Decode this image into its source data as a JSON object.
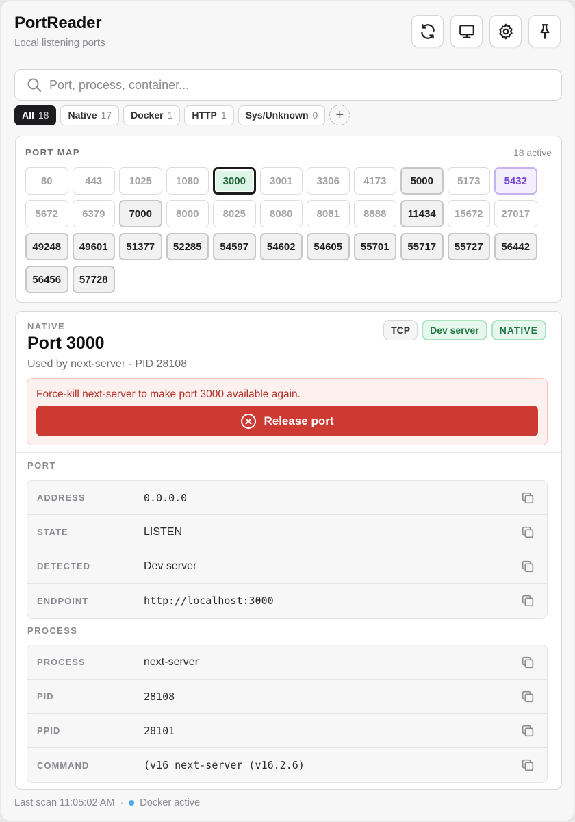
{
  "header": {
    "title": "PortReader",
    "subtitle": "Local listening ports",
    "buttons": [
      "refresh-icon",
      "monitor-icon",
      "gear-icon",
      "pin-icon"
    ]
  },
  "search": {
    "placeholder": "Port, process, container...",
    "value": ""
  },
  "filters": [
    {
      "label": "All",
      "count": "18",
      "active": true
    },
    {
      "label": "Native",
      "count": "17"
    },
    {
      "label": "Docker",
      "count": "1"
    },
    {
      "label": "HTTP",
      "count": "1"
    },
    {
      "label": "Sys/Unknown",
      "count": "0"
    }
  ],
  "port_map": {
    "title": "PORT MAP",
    "active_label": "18 active",
    "ports": [
      {
        "n": "80",
        "s": "off"
      },
      {
        "n": "443",
        "s": "off"
      },
      {
        "n": "1025",
        "s": "off"
      },
      {
        "n": "1080",
        "s": "off"
      },
      {
        "n": "3000",
        "s": "sel"
      },
      {
        "n": "3001",
        "s": "off"
      },
      {
        "n": "3306",
        "s": "off"
      },
      {
        "n": "4173",
        "s": "off"
      },
      {
        "n": "5000",
        "s": "on"
      },
      {
        "n": "5173",
        "s": "off"
      },
      {
        "n": "5432",
        "s": "purple"
      },
      {
        "n": "5672",
        "s": "off"
      },
      {
        "n": "6379",
        "s": "off"
      },
      {
        "n": "7000",
        "s": "on"
      },
      {
        "n": "8000",
        "s": "off"
      },
      {
        "n": "8025",
        "s": "off"
      },
      {
        "n": "8080",
        "s": "off"
      },
      {
        "n": "8081",
        "s": "off"
      },
      {
        "n": "8888",
        "s": "off"
      },
      {
        "n": "11434",
        "s": "on"
      },
      {
        "n": "15672",
        "s": "off"
      },
      {
        "n": "27017",
        "s": "off"
      },
      {
        "n": "49248",
        "s": "on"
      },
      {
        "n": "49601",
        "s": "on"
      },
      {
        "n": "51377",
        "s": "on"
      },
      {
        "n": "52285",
        "s": "on"
      },
      {
        "n": "54597",
        "s": "on"
      },
      {
        "n": "54602",
        "s": "on"
      },
      {
        "n": "54605",
        "s": "on"
      },
      {
        "n": "55701",
        "s": "on"
      },
      {
        "n": "55717",
        "s": "on"
      },
      {
        "n": "55727",
        "s": "on"
      },
      {
        "n": "56442",
        "s": "on"
      },
      {
        "n": "56456",
        "s": "on"
      },
      {
        "n": "57728",
        "s": "on"
      }
    ]
  },
  "detail": {
    "kind": "NATIVE",
    "title": "Port 3000",
    "used_by": "Used by next-server - PID 28108",
    "badges": {
      "tcp": "TCP",
      "dev": "Dev server",
      "native": "NATIVE"
    },
    "warning": "Force-kill next-server to make port 3000 available again.",
    "release_label": "Release port",
    "port_section": "PORT",
    "port_rows": [
      {
        "key": "ADDRESS",
        "value": "0.0.0.0",
        "mono": true
      },
      {
        "key": "STATE",
        "value": "LISTEN",
        "mono": false
      },
      {
        "key": "DETECTED",
        "value": "Dev server",
        "mono": false
      },
      {
        "key": "ENDPOINT",
        "value": "http://localhost:3000",
        "mono": true
      }
    ],
    "process_section": "PROCESS",
    "process_rows": [
      {
        "key": "PROCESS",
        "value": "next-server",
        "mono": false
      },
      {
        "key": "PID",
        "value": "28108",
        "mono": true
      },
      {
        "key": "PPID",
        "value": "28101",
        "mono": true
      },
      {
        "key": "COMMAND",
        "value": "(v16 next-server (v16.2.6)",
        "mono": true
      }
    ]
  },
  "footer": {
    "last_scan": "Last scan 11:05:02 AM",
    "separator": "·",
    "docker": "Docker active"
  },
  "colors": {
    "accent_red": "#cc3a32",
    "selected_green": "#dcf5e6",
    "purple": "#7340d2",
    "docker_dot": "#4fa8e6"
  }
}
